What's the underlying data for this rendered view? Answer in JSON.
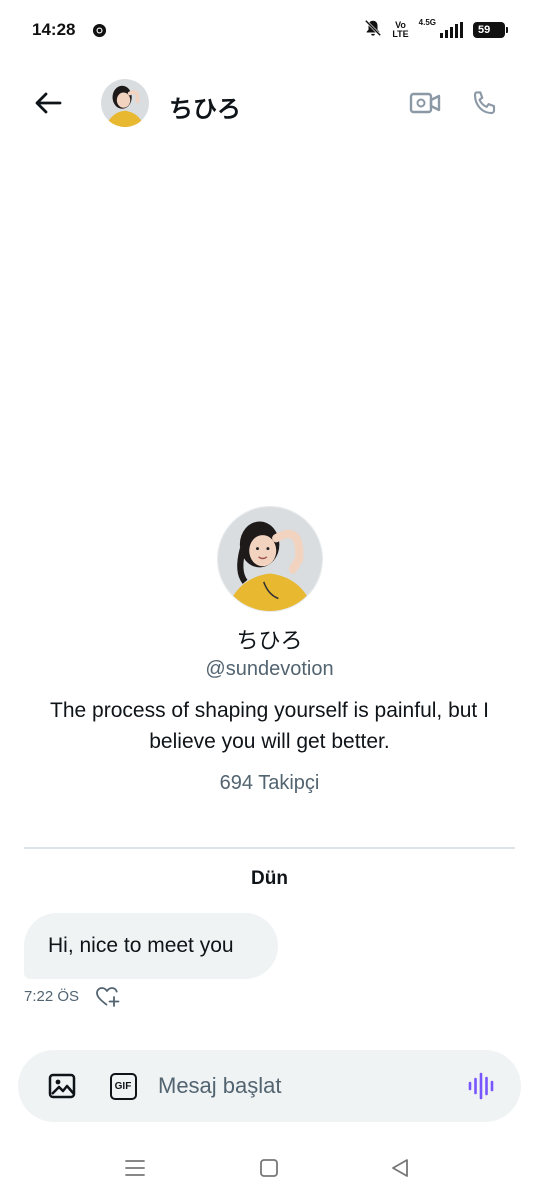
{
  "status_bar": {
    "time": "14:28",
    "volte_line1": "Vo",
    "volte_line2": "LTE",
    "network": "4.5G",
    "battery": "59",
    "icons": [
      "chrome-icon",
      "muted-bell-icon",
      "volte-icon",
      "signal-icon",
      "battery-icon"
    ]
  },
  "header": {
    "contact_name": "ちひろ",
    "icons": [
      "back-arrow-icon",
      "avatar",
      "video-call-icon",
      "phone-call-icon"
    ]
  },
  "profile": {
    "name": "ちひろ",
    "handle": "@sundevotion",
    "bio": "The process of shaping yourself is painful, but I believe you will get better.",
    "followers": "694 Takipçi"
  },
  "conversation": {
    "date_separator": "Dün",
    "messages": [
      {
        "text": "Hi, nice to meet you",
        "time": "7:22 ÖS",
        "direction": "incoming"
      }
    ]
  },
  "composer": {
    "placeholder": "Mesaj başlat",
    "gif_label": "GIF",
    "icons": [
      "image-icon",
      "gif-icon",
      "voice-message-icon"
    ]
  },
  "nav_bar": {
    "icons": [
      "recents-icon",
      "home-icon",
      "back-triangle-icon"
    ]
  },
  "colors": {
    "text_primary": "#0f1419",
    "text_secondary": "#536471",
    "bubble_bg": "#eff3f4",
    "divider": "#dce3e9",
    "voice_accent": "#7856ff",
    "avatar_shirt": "#e8b830"
  }
}
